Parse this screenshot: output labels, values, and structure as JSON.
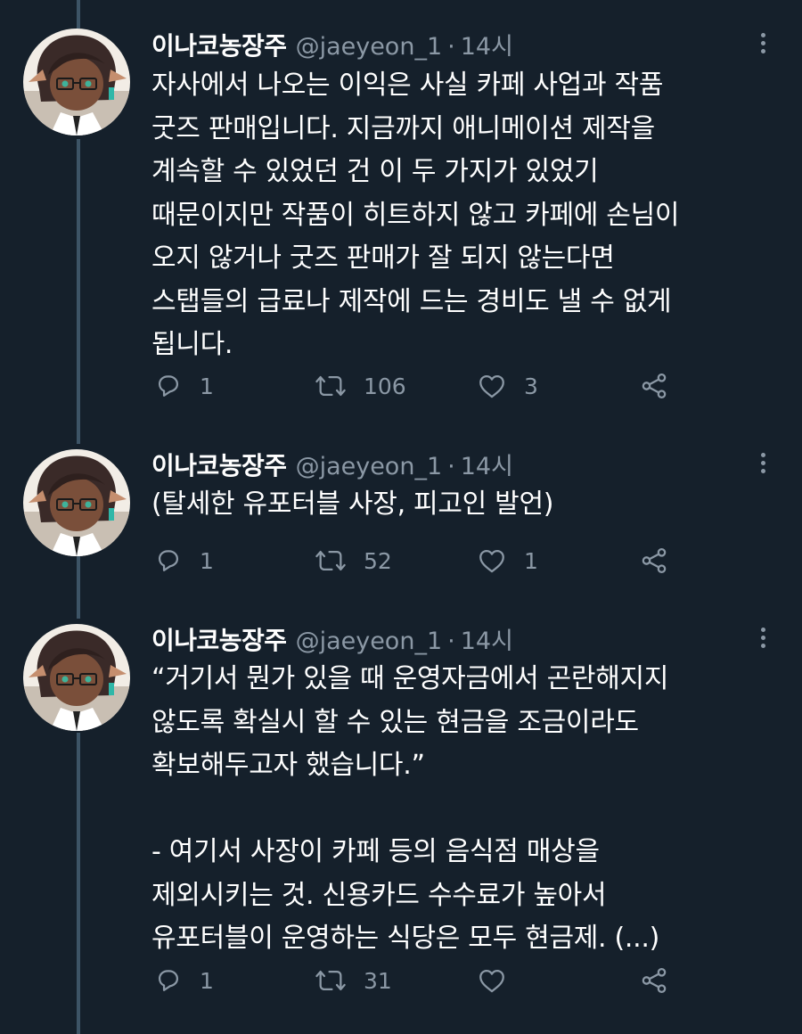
{
  "tweets": [
    {
      "name": "이나코농장주",
      "handle": "@jaeyeon_1",
      "separator": "·",
      "time": "14시",
      "lines": [
        "자사에서 나오는 이익은 사실 카페 사업과 작품",
        "굿즈 판매입니다. 지금까지 애니메이션 제작을",
        "계속할 수 있었던 건 이 두 가지가 있었기",
        "때문이지만 작품이 히트하지 않고 카페에 손님이",
        "오지 않거나 굿즈 판매가 잘 되지 않는다면",
        "스탭들의 급료나 제작에 드는 경비도 낼 수 없게",
        "됩니다."
      ],
      "reply_count": "1",
      "retweet_count": "106",
      "like_count": "3"
    },
    {
      "name": "이나코농장주",
      "handle": "@jaeyeon_1",
      "separator": "·",
      "time": "14시",
      "lines": [
        "(탈세한 유포터블 사장, 피고인 발언)"
      ],
      "reply_count": "1",
      "retweet_count": "52",
      "like_count": "1"
    },
    {
      "name": "이나코농장주",
      "handle": "@jaeyeon_1",
      "separator": "·",
      "time": "14시",
      "lines": [
        "“거기서 뭔가 있을 때 운영자금에서 곤란해지지",
        "않도록 확실시 할 수 있는 현금을 조금이라도",
        "확보해두고자 했습니다.”",
        "",
        "- 여기서 사장이 카페 등의 음식점 매상을",
        "제외시키는 것. 신용카드 수수료가 높아서",
        "유포터블이 운영하는 식당은 모두 현금제. (...)"
      ],
      "reply_count": "1",
      "retweet_count": "31",
      "like_count": ""
    }
  ],
  "icons": {
    "reply": "reply-icon",
    "retweet": "retweet-icon",
    "like": "like-icon",
    "share": "share-icon",
    "more": "more-options-icon"
  },
  "colors": {
    "background": "#15202b",
    "text": "#ffffff",
    "secondary": "#8b98a5",
    "thread_line": "#3d5466"
  }
}
